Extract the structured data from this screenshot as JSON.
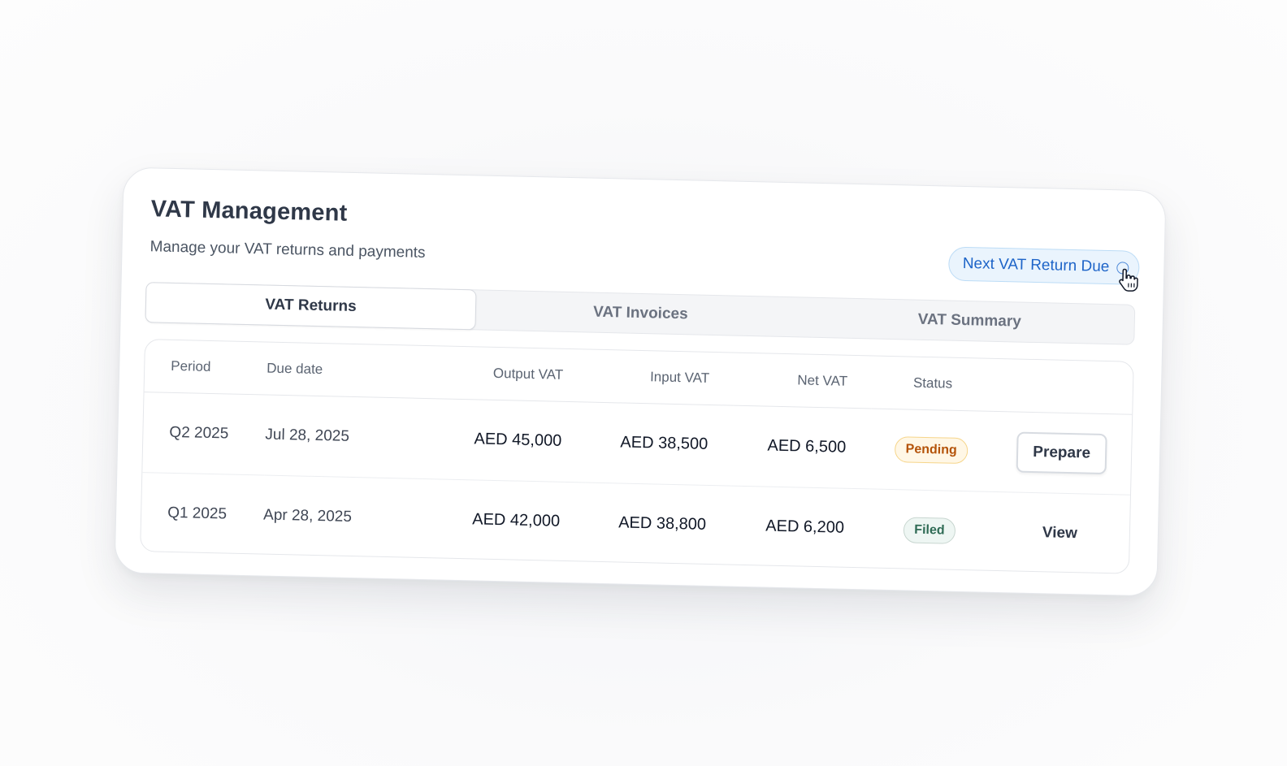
{
  "header": {
    "title": "VAT Management",
    "subtitle": "Manage your VAT returns and payments",
    "due_button_label": "Next VAT Return Due"
  },
  "tabs": [
    {
      "label": "VAT Returns",
      "active": true
    },
    {
      "label": "VAT Invoices",
      "active": false
    },
    {
      "label": "VAT Summary",
      "active": false
    }
  ],
  "table": {
    "columns": [
      "Period",
      "Due date",
      "Output VAT",
      "Input VAT",
      "Net VAT",
      "Status"
    ],
    "rows": [
      {
        "period": "Q2 2025",
        "due_date": "Jul 28, 2025",
        "output_vat": "AED 45,000",
        "input_vat": "AED 38,500",
        "net_vat": "AED 6,500",
        "status": "Pending",
        "action": "Prepare"
      },
      {
        "period": "Q1 2025",
        "due_date": "Apr 28, 2025",
        "output_vat": "AED 42,000",
        "input_vat": "AED 38,800",
        "net_vat": "AED 6,200",
        "status": "Filed",
        "action": "View"
      }
    ]
  },
  "colors": {
    "accent_blue": "#1d64c8",
    "pending": "#b45309",
    "filed": "#2f6b55"
  },
  "icons": [
    "info-icon",
    "pointer-cursor-icon"
  ]
}
